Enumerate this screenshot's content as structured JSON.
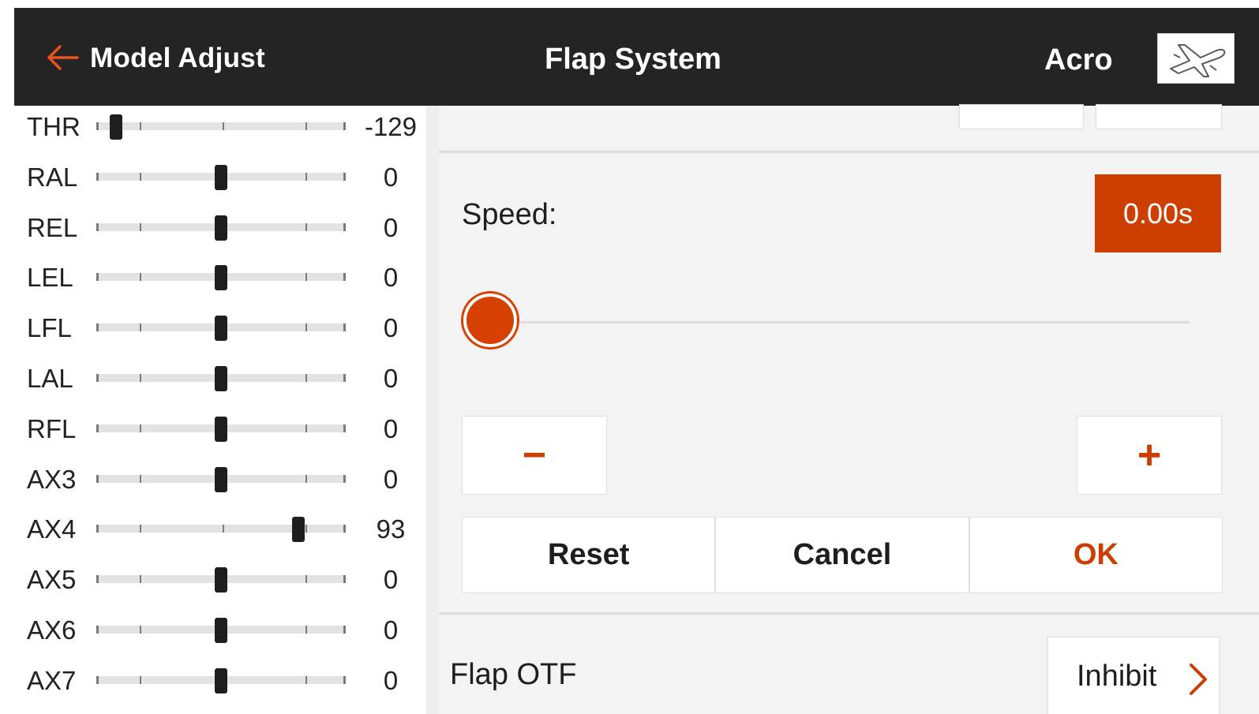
{
  "header": {
    "back_label": "Model Adjust",
    "title": "Flap System",
    "model_type": "Acro",
    "back_icon": "back-arrow-icon",
    "model_icon": "airplane-icon"
  },
  "colors": {
    "accent": "#cc3f00",
    "header_bg": "#242424",
    "panel_bg": "#f3f3f3"
  },
  "channels": [
    {
      "label": "THR",
      "value": "-129",
      "position": 0.08
    },
    {
      "label": "RAL",
      "value": "0",
      "position": 0.5
    },
    {
      "label": "REL",
      "value": "0",
      "position": 0.5
    },
    {
      "label": "LEL",
      "value": "0",
      "position": 0.5
    },
    {
      "label": "LFL",
      "value": "0",
      "position": 0.5
    },
    {
      "label": "LAL",
      "value": "0",
      "position": 0.5
    },
    {
      "label": "RFL",
      "value": "0",
      "position": 0.5
    },
    {
      "label": "AX3",
      "value": "0",
      "position": 0.5
    },
    {
      "label": "AX4",
      "value": "93",
      "position": 0.81
    },
    {
      "label": "AX5",
      "value": "0",
      "position": 0.5
    },
    {
      "label": "AX6",
      "value": "0",
      "position": 0.5
    },
    {
      "label": "AX7",
      "value": "0",
      "position": 0.5
    }
  ],
  "speed": {
    "label": "Speed:",
    "value": "0.00s",
    "slider_fraction": 0
  },
  "buttons": {
    "decrement": "−",
    "increment": "+",
    "reset": "Reset",
    "cancel": "Cancel",
    "ok": "OK"
  },
  "flap_otf": {
    "label": "Flap OTF",
    "value": "Inhibit",
    "chevron_icon": "chevron-right-icon"
  }
}
